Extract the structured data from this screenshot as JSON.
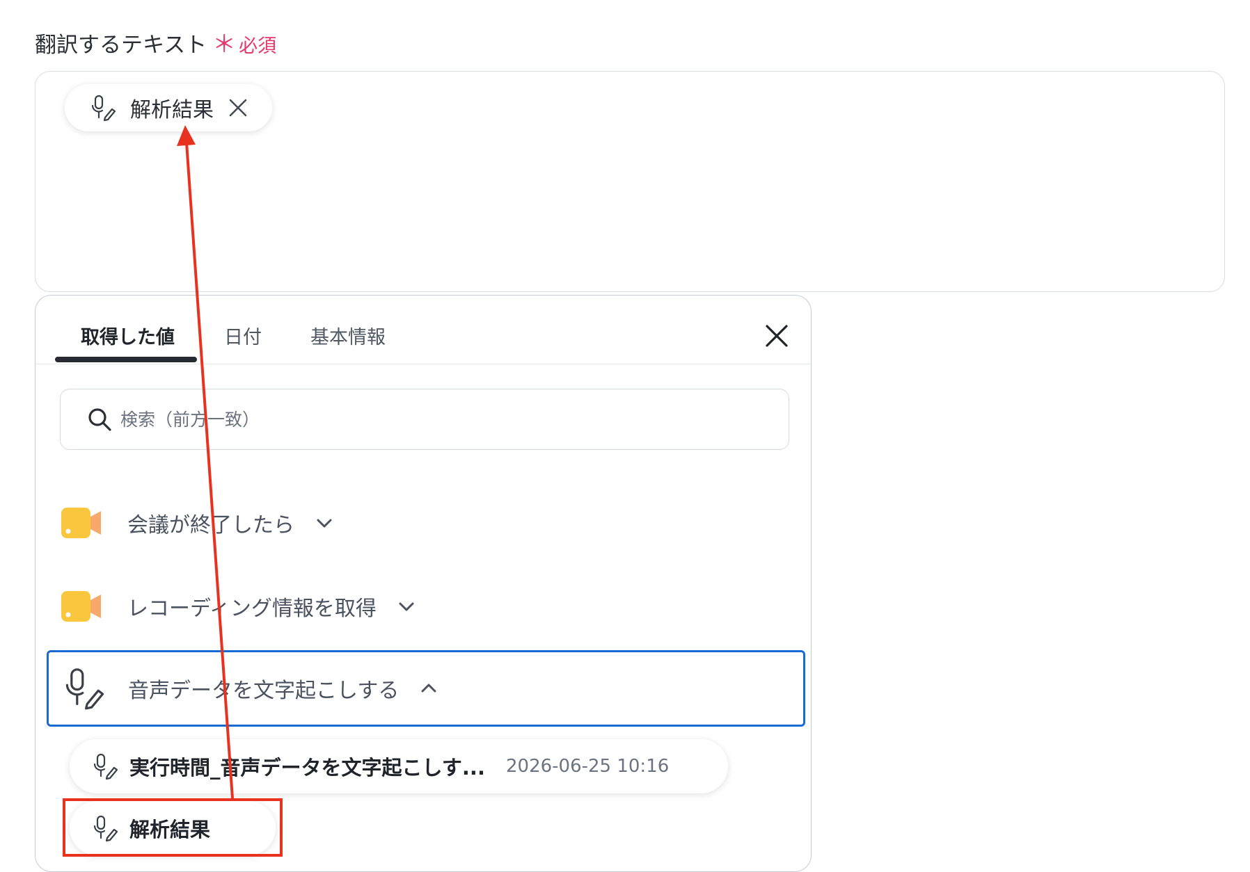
{
  "field": {
    "label": "翻訳するテキスト",
    "required_mark": "＊",
    "required_text": "必須"
  },
  "selected_chip": {
    "label": "解析結果",
    "icon": "mic-pencil-icon"
  },
  "panel": {
    "tabs": [
      {
        "label": "取得した値",
        "active": true
      },
      {
        "label": "日付",
        "active": false
      },
      {
        "label": "基本情報",
        "active": false
      }
    ],
    "search": {
      "placeholder": "検索（前方一致）"
    },
    "groups": [
      {
        "label": "会議が終了したら",
        "icon": "zoom-camera-icon",
        "expanded": false
      },
      {
        "label": "レコーディング情報を取得",
        "icon": "zoom-camera-icon",
        "expanded": false
      },
      {
        "label": "音声データを文字起こしする",
        "icon": "mic-pencil-icon",
        "expanded": true
      }
    ],
    "items": [
      {
        "label": "実行時間_音声データを文字起こしす...",
        "meta": "2026-06-25 10:16"
      },
      {
        "label": "解析結果"
      }
    ]
  },
  "colors": {
    "required": "#e5396b",
    "selected_border": "#1a6ad4",
    "annotation_red": "#e8321f",
    "zoom_yellow": "#f9c63d"
  }
}
